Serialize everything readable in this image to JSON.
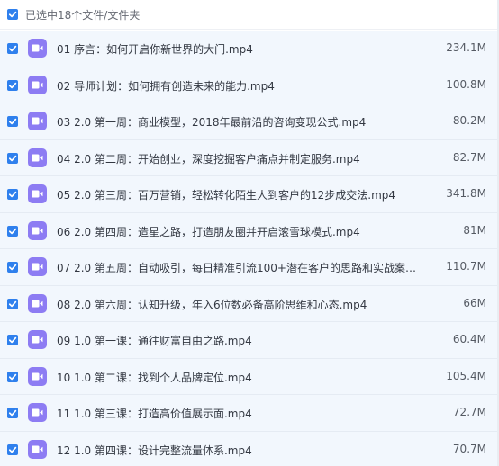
{
  "header": {
    "selected_text": "已选中18个文件/文件夹"
  },
  "icons": {
    "checkbox": "checkbox-checked-icon",
    "file": "video-file-icon"
  },
  "colors": {
    "accent": "#2f80ed",
    "video_icon": "#8d7cf3",
    "row_background": "#f2f7fd"
  },
  "files": [
    {
      "name": "01 序言：如何开启你新世界的大门.mp4",
      "size": "234.1M"
    },
    {
      "name": "02 导师计划：如何拥有创造未来的能力.mp4",
      "size": "100.8M"
    },
    {
      "name": "03 2.0 第一周：商业模型，2018年最前沿的咨询变现公式.mp4",
      "size": "80.2M"
    },
    {
      "name": "04 2.0 第二周：开始创业，深度挖掘客户痛点并制定服务.mp4",
      "size": "82.7M"
    },
    {
      "name": "05 2.0 第三周：百万营销，轻松转化陌生人到客户的12步成交法.mp4",
      "size": "341.8M"
    },
    {
      "name": "06 2.0 第四周：造星之路，打造朋友圈并开启滚雪球模式.mp4",
      "size": "81M"
    },
    {
      "name": "07 2.0 第五周：自动吸引，每日精准引流100+潜在客户的思路和实战案例....",
      "size": "110.7M"
    },
    {
      "name": "08 2.0 第六周：认知升级，年入6位数必备高阶思维和心态.mp4",
      "size": "66M"
    },
    {
      "name": "09 1.0 第一课：通往财富自由之路.mp4",
      "size": "60.4M"
    },
    {
      "name": "10 1.0 第二课：找到个人品牌定位.mp4",
      "size": "105.4M"
    },
    {
      "name": "11 1.0 第三课：打造高价值展示面.mp4",
      "size": "72.7M"
    },
    {
      "name": "12 1.0 第四课：设计完整流量体系.mp4",
      "size": "70.7M"
    }
  ]
}
